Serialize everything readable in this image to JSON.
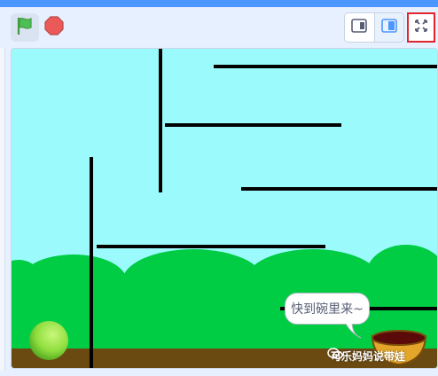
{
  "toolbar": {
    "green_flag_icon": "green-flag-icon",
    "stop_icon": "stop-sign-icon",
    "small_stage_icon": "small-stage-icon",
    "large_stage_icon": "large-stage-icon",
    "fullscreen_icon": "fullscreen-icon"
  },
  "stage": {
    "speech_bubble": "快到碗里来~",
    "watermark": "可乐妈妈说带娃"
  },
  "colors": {
    "accent": "#4c97ff",
    "sky": "#9bfbfc",
    "hills": "#00cc44",
    "ground": "#6b4a12",
    "highlight_border": "#e0262c",
    "ball": "#8fde3e",
    "bowl": "#e3a52a"
  }
}
